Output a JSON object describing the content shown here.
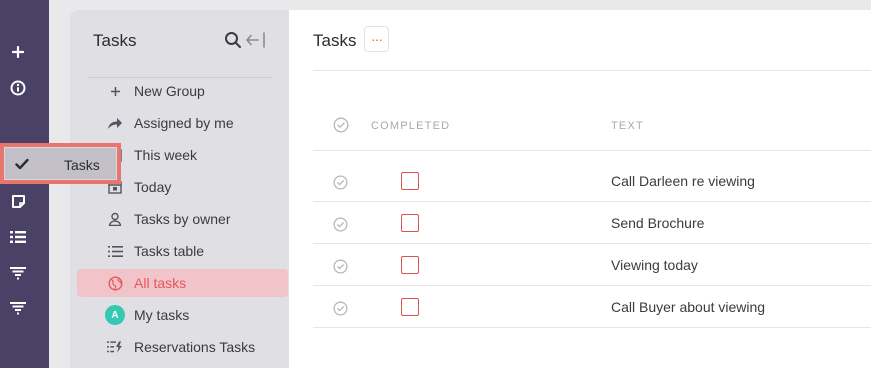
{
  "rail": {
    "icons": [
      "plus-icon",
      "info-icon",
      "note-icon",
      "list-icon",
      "funnel-icon",
      "funnel-icon"
    ]
  },
  "tooltip": {
    "label": "Tasks"
  },
  "panel": {
    "title": "Tasks",
    "items": [
      {
        "label": "New Group",
        "icon": "plus-icon"
      },
      {
        "label": "Assigned by me",
        "icon": "share-arrow-icon"
      },
      {
        "label": "This week",
        "icon": "calendar-icon"
      },
      {
        "label": "Today",
        "icon": "calendar-day-icon"
      },
      {
        "label": "Tasks by owner",
        "icon": "user-icon"
      },
      {
        "label": "Tasks table",
        "icon": "list-icon"
      },
      {
        "label": "All tasks",
        "icon": "globe-icon",
        "active": true
      },
      {
        "label": "My tasks",
        "icon": "avatar",
        "avatar_letter": "A"
      },
      {
        "label": "Reservations Tasks",
        "icon": "list-lightning-icon"
      }
    ]
  },
  "main": {
    "title": "Tasks",
    "more_label": "···",
    "columns": {
      "completed": "COMPLETED",
      "text": "TEXT"
    },
    "rows": [
      {
        "text": "Call Darleen re viewing",
        "completed": false
      },
      {
        "text": "Send Brochure",
        "completed": false
      },
      {
        "text": "Viewing today",
        "completed": false
      },
      {
        "text": "Call Buyer about viewing",
        "completed": false
      }
    ]
  },
  "colors": {
    "rail": "#4a4266",
    "accent": "#e8565e",
    "tooltip_border": "#e8756f",
    "avatar": "#35c9b4"
  }
}
